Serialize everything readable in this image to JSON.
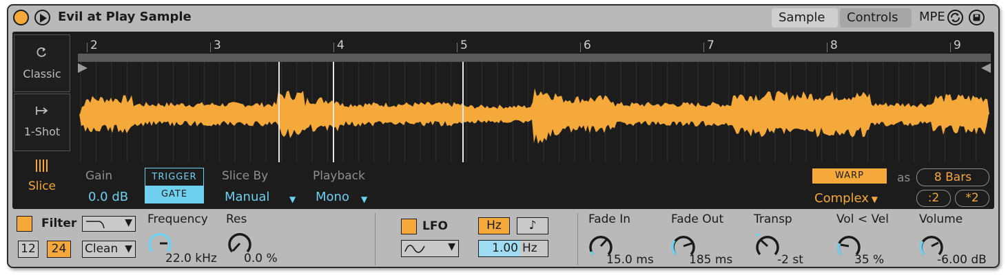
{
  "title": "Evil at Play Sample",
  "tabs": {
    "sample": "Sample",
    "controls": "Controls",
    "mpe": "MPE"
  },
  "modes": {
    "classic": {
      "label": "Classic",
      "icon": "loop-icon"
    },
    "oneshot": {
      "label": "1-Shot",
      "icon": "one-shot-arrow-icon"
    },
    "slice": {
      "label": "Slice",
      "icon": "slice-bars-icon"
    }
  },
  "ruler": {
    "bars": [
      "2",
      "3",
      "4",
      "5",
      "6",
      "7",
      "8",
      "9"
    ]
  },
  "params": {
    "gain": {
      "label": "Gain",
      "value": "0.0 dB"
    },
    "trigger_gate": {
      "trigger": "TRIGGER",
      "gate": "GATE",
      "active": "gate"
    },
    "slice_by": {
      "label": "Slice By",
      "value": "Manual"
    },
    "playback": {
      "label": "Playback",
      "value": "Mono"
    }
  },
  "warp": {
    "button": "WARP",
    "mode": "Complex",
    "as_label": "as",
    "length": "8 Bars",
    "half": ":2",
    "double": "*2"
  },
  "filter": {
    "label": "Filter",
    "enabled": true,
    "slope_12": "12",
    "slope_24": "24",
    "active_slope": "24",
    "type_icon": "lowpass-curve-icon",
    "circuit": "Clean",
    "frequency": {
      "label": "Frequency",
      "value": "22.0 kHz"
    },
    "res": {
      "label": "Res",
      "value": "0.0 %"
    }
  },
  "lfo": {
    "label": "LFO",
    "enabled": true,
    "wave_icon": "sine-wave-icon",
    "hz_label": "Hz",
    "note_icon": "eighth-note-icon",
    "rate": "1.00",
    "rate_unit": "Hz"
  },
  "envelope": {
    "fade_in": {
      "label": "Fade In",
      "value": "15.0 ms"
    },
    "fade_out": {
      "label": "Fade Out",
      "value": "185 ms"
    },
    "transp": {
      "label": "Transp",
      "value": "-2 st"
    },
    "vol_vel": {
      "label": "Vol < Vel",
      "value": "35 %"
    },
    "volume": {
      "label": "Volume",
      "value": "-6.00 dB"
    }
  },
  "colors": {
    "accent": "#f5a93a",
    "blue": "#6fd0f0",
    "panel": "#1c1c1c",
    "device": "#b9b9b9"
  }
}
